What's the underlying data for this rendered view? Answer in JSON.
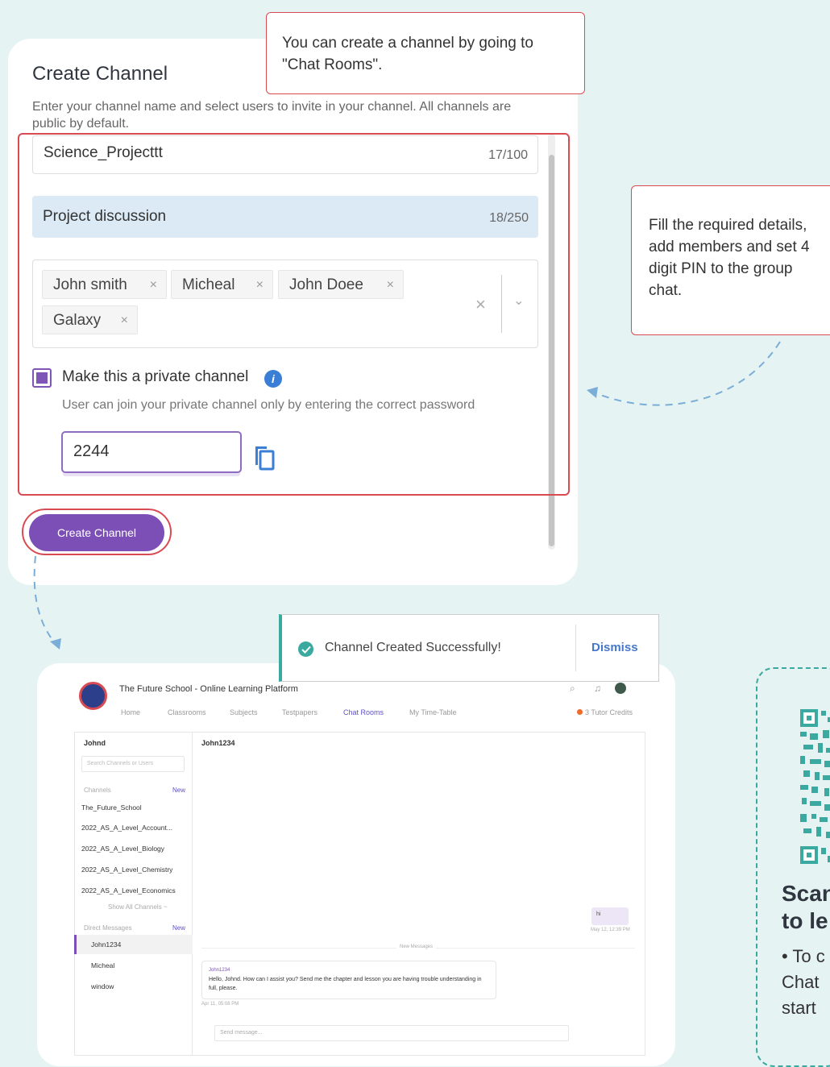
{
  "callouts": {
    "create_hint": "You can create a channel by going to \"Chat Rooms\".",
    "fill_hint": "Fill the required details, add members and set 4 digit PIN to the group chat."
  },
  "form": {
    "title": "Create Channel",
    "description": "Enter your channel name and select users to invite in your channel. All channels are public by default.",
    "channel_name": {
      "value": "Science_Projecttt",
      "counter": "17/100"
    },
    "channel_description": {
      "value": "Project discussion",
      "counter": "18/250"
    },
    "members": [
      "John smith",
      "Micheal",
      "John Doee",
      "Galaxy"
    ],
    "chip_remove": "×",
    "clear_all": "×",
    "dropdown": "⌄",
    "private_label": "Make this a private channel",
    "private_checked": true,
    "info": "i",
    "private_help": "User can join your private channel only by entering the correct password",
    "pin": "2244",
    "submit": "Create Channel"
  },
  "toast": {
    "message": "Channel Created Successfully!",
    "action": "Dismiss"
  },
  "screenshot": {
    "title": "The Future School - Online Learning Platform",
    "nav": [
      "Home",
      "Classrooms",
      "Subjects",
      "Testpapers",
      "Chat Rooms",
      "My Time-Table"
    ],
    "nav_active": "Chat Rooms",
    "credits": "3 Tutor Credits",
    "user": "Johnd",
    "search_placeholder": "Search Channels or Users",
    "channels_label": "Channels",
    "new_label": "New",
    "channels": [
      "The_Future_School",
      "2022_AS_A_Level_Account...",
      "2022_AS_A_Level_Biology",
      "2022_AS_A_Level_Chemistry",
      "2022_AS_A_Level_Economics"
    ],
    "show_all": "Show All Channels ~",
    "dm_label": "Direct Messages",
    "dms": [
      "John1234",
      "Micheal",
      "window"
    ],
    "chat_header": "John1234",
    "bubble_text": "hi",
    "bubble_time": "May 12, 12:39 PM",
    "new_messages": "New Messages",
    "msg_sender": "John1234",
    "msg_text": "Hello, Johnd. How can I assist you? Send me the chapter and lesson you are having trouble understanding in full, please.",
    "msg_time": "Apr 11, 05:08 PM",
    "send_placeholder": "Send message..."
  },
  "qr_card": {
    "line1": "Scan",
    "line2": "to le",
    "bullet1": "• To c",
    "line3": "Chat",
    "line4": "start"
  },
  "colors": {
    "accent": "#7c4fb6",
    "callout_border": "#d94b52",
    "success": "#3aa99f",
    "link": "#4578c8",
    "background": "#e6f3f3"
  }
}
